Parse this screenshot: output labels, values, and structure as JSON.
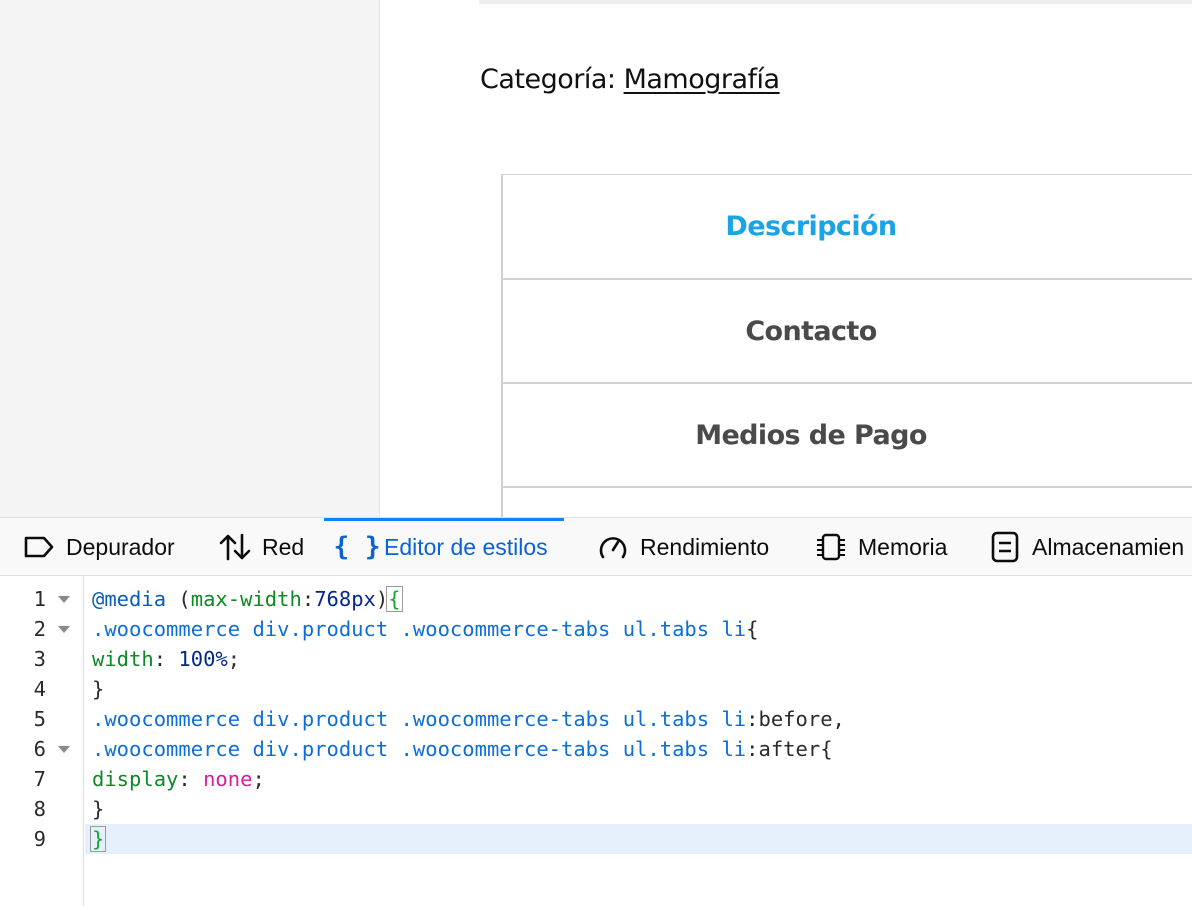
{
  "page": {
    "category_label": "Categoría: ",
    "category_link": "Mamografía",
    "tabs": [
      {
        "label": "Descripción",
        "active": true
      },
      {
        "label": "Contacto",
        "active": false
      },
      {
        "label": "Medios de Pago",
        "active": false
      }
    ],
    "colors": {
      "active_tab": "#1aa4e6",
      "tab_text": "#4a4a4a"
    }
  },
  "devtools": {
    "tabs": [
      {
        "label": "Depurador",
        "icon": "debugger-icon"
      },
      {
        "label": "Red",
        "icon": "network-arrows-icon"
      },
      {
        "label": "Editor de estilos",
        "icon": "braces-icon",
        "selected": true
      },
      {
        "label": "Rendimiento",
        "icon": "gauge-icon"
      },
      {
        "label": "Memoria",
        "icon": "memory-chip-icon"
      },
      {
        "label": "Almacenamien",
        "icon": "storage-icon"
      }
    ],
    "editor": {
      "line_numbers": [
        "1",
        "2",
        "3",
        "4",
        "5",
        "6",
        "7",
        "8",
        "9"
      ],
      "active_line": 9,
      "lines": [
        [
          {
            "t": "@media",
            "c": "at"
          },
          {
            "t": " (",
            "c": "plain"
          },
          {
            "t": "max-width",
            "c": "prop"
          },
          {
            "t": ":",
            "c": "plain"
          },
          {
            "t": "768px",
            "c": "num"
          },
          {
            "t": ")",
            "c": "plain"
          },
          {
            "t": "{",
            "c": "brace"
          }
        ],
        [
          {
            "t": ".woocommerce div.product .woocommerce-tabs ul.tabs li",
            "c": "sel"
          },
          {
            "t": "{",
            "c": "plain"
          }
        ],
        [
          {
            "t": "width",
            "c": "prop"
          },
          {
            "t": ": ",
            "c": "plain"
          },
          {
            "t": "100%",
            "c": "num"
          },
          {
            "t": ";",
            "c": "plain"
          }
        ],
        [
          {
            "t": "}",
            "c": "plain"
          }
        ],
        [
          {
            "t": ".woocommerce div.product .woocommerce-tabs ul.tabs li",
            "c": "sel"
          },
          {
            "t": ":before,",
            "c": "plain"
          }
        ],
        [
          {
            "t": ".woocommerce div.product .woocommerce-tabs ul.tabs li",
            "c": "sel"
          },
          {
            "t": ":after{",
            "c": "plain"
          }
        ],
        [
          {
            "t": "display",
            "c": "prop"
          },
          {
            "t": ": ",
            "c": "plain"
          },
          {
            "t": "none",
            "c": "kw"
          },
          {
            "t": ";",
            "c": "plain"
          }
        ],
        [
          {
            "t": "}",
            "c": "plain"
          }
        ],
        [
          {
            "t": "}",
            "c": "brace"
          }
        ]
      ],
      "foldable_lines": [
        1,
        2,
        6
      ]
    }
  }
}
